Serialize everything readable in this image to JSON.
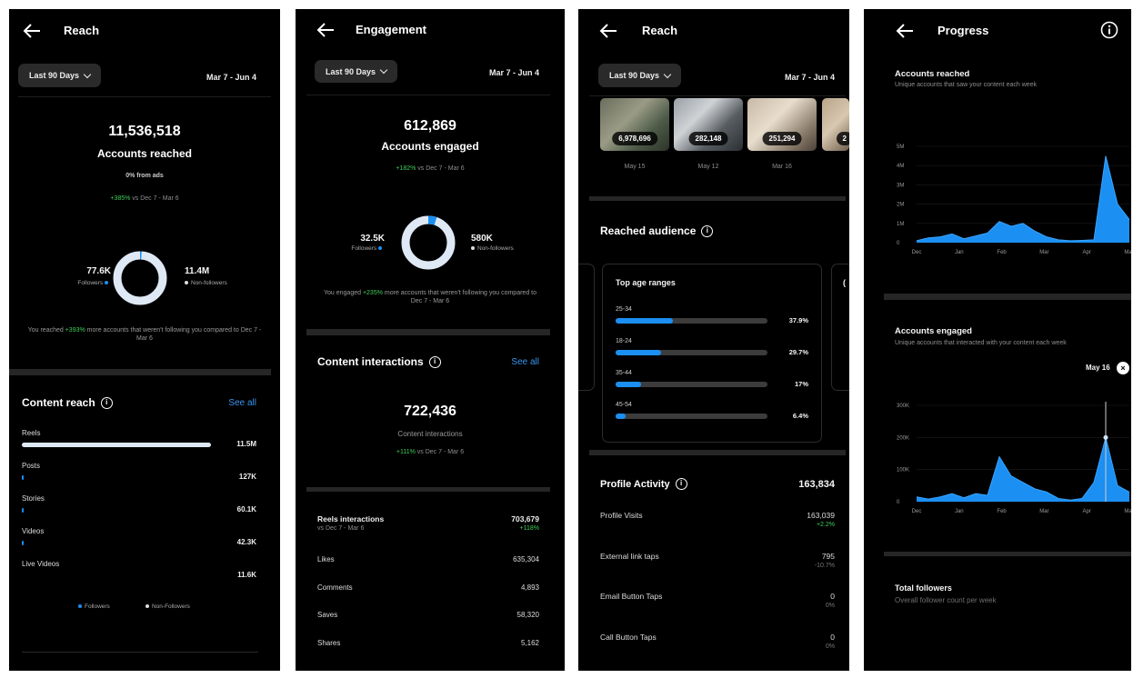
{
  "colors": {
    "accent": "#1b8ff2",
    "positive": "#3ecf5a",
    "background": "#000000"
  },
  "s1": {
    "title": "Reach",
    "filter": "Last 90 Days",
    "date_range": "Mar 7 - Jun 4",
    "total": "11,536,518",
    "total_label": "Accounts reached",
    "from_ads": "0% from ads",
    "change": "+385%",
    "change_suffix": " vs Dec 7 - Mar 6",
    "followers_value": "77.6K",
    "followers_label": "Followers",
    "nonfollowers_value": "11.4M",
    "nonfollowers_label": "Non-followers",
    "note_prefix": "You reached ",
    "note_highlight": "+393%",
    "note_suffix": " more accounts that weren't following you compared to Dec 7 - Mar 6",
    "section_title": "Content reach",
    "see_all": "See all",
    "content": [
      {
        "label": "Reels",
        "value": "11.5M",
        "fraction": 1.0
      },
      {
        "label": "Posts",
        "value": "127K",
        "fraction": 0.011
      },
      {
        "label": "Stories",
        "value": "60.1K",
        "fraction": 0.005
      },
      {
        "label": "Videos",
        "value": "42.3K",
        "fraction": 0.0
      },
      {
        "label": "Live Videos",
        "value": "11.6K",
        "fraction": 0.0
      }
    ],
    "legend_followers": "Followers",
    "legend_nonfollowers": "Non-Followers"
  },
  "s2": {
    "title": "Engagement",
    "filter": "Last 90 Days",
    "date_range": "Mar 7 - Jun 4",
    "total": "612,869",
    "total_label": "Accounts engaged",
    "change": "+182%",
    "change_suffix": " vs Dec 7 - Mar 6",
    "followers_value": "32.5K",
    "followers_label": "Followers",
    "nonfollowers_value": "580K",
    "nonfollowers_label": "Non-followers",
    "note_prefix": "You engaged ",
    "note_highlight": "+235%",
    "note_suffix": " more accounts that weren't following you compared to Dec 7 - Mar 6",
    "section_title": "Content interactions",
    "see_all": "See all",
    "interactions_total": "722,436",
    "interactions_label": "Content interactions",
    "interactions_change": "+111%",
    "interactions_change_suffix": " vs Dec 7 - Mar 6",
    "reels_label": "Reels interactions",
    "reels_sub": "vs Dec 7 - Mar 6",
    "reels_value": "703,679",
    "reels_change": "+118%",
    "rows": [
      {
        "label": "Likes",
        "value": "635,304"
      },
      {
        "label": "Comments",
        "value": "4,893"
      },
      {
        "label": "Saves",
        "value": "58,320"
      },
      {
        "label": "Shares",
        "value": "5,162"
      }
    ]
  },
  "s3": {
    "title": "Reach",
    "filter": "Last 90 Days",
    "date_range": "Mar 7 - Jun 4",
    "thumbs": [
      {
        "value": "6,978,696",
        "date": "May 15"
      },
      {
        "value": "282,148",
        "date": "May 12"
      },
      {
        "value": "251,294",
        "date": "Mar 16"
      },
      {
        "value": "2",
        "date": ""
      }
    ],
    "audience_title": "Reached audience",
    "age_title": "Top age ranges",
    "ages": [
      {
        "label": "25-34",
        "value": "37.9%",
        "fraction": 0.379
      },
      {
        "label": "18-24",
        "value": "29.7%",
        "fraction": 0.297
      },
      {
        "label": "35-44",
        "value": "17%",
        "fraction": 0.17
      },
      {
        "label": "45-54",
        "value": "6.4%",
        "fraction": 0.064
      }
    ],
    "activity_title": "Profile Activity",
    "activity_total": "163,834",
    "activity": [
      {
        "label": "Profile Visits",
        "value": "163,039",
        "change": "+2.2%"
      },
      {
        "label": "External link taps",
        "value": "795",
        "change": "-10.7%"
      },
      {
        "label": "Email Button Taps",
        "value": "0",
        "change": "0%"
      },
      {
        "label": "Call Button Taps",
        "value": "0",
        "change": "0%"
      }
    ]
  },
  "s4": {
    "title": "Progress",
    "reached_title": "Accounts reached",
    "reached_sub": "Unique accounts that saw your content each week",
    "engaged_title": "Accounts engaged",
    "engaged_sub": "Unique accounts that interacted with your content each week",
    "tooltip_date": "May 16",
    "followers_title": "Total followers",
    "followers_sub": "Overall follower count per week"
  },
  "chart_data": [
    {
      "type": "area",
      "title": "Accounts reached",
      "x": [
        "Dec",
        "",
        "Jan",
        "",
        "Feb",
        "",
        "Mar",
        "",
        "Apr",
        "",
        "May",
        ""
      ],
      "x_ticks": [
        "Dec",
        "Jan",
        "Feb",
        "Mar",
        "Apr",
        "May"
      ],
      "y_ticks": [
        "0",
        "1M",
        "2M",
        "3M",
        "4M",
        "5M"
      ],
      "ylim": [
        0,
        5000000
      ],
      "series": [
        {
          "values": [
            100000,
            250000,
            300000,
            450000,
            200000,
            350000,
            500000,
            1100000,
            850000,
            1000000,
            600000,
            300000,
            150000,
            100000,
            120000,
            150000,
            4500000,
            2000000,
            1200000
          ]
        }
      ]
    },
    {
      "type": "area",
      "title": "Accounts engaged",
      "x_ticks": [
        "Dec",
        "Jan",
        "Feb",
        "Mar",
        "Apr",
        "May"
      ],
      "y_ticks": [
        "0",
        "100K",
        "200K",
        "300K"
      ],
      "ylim": [
        0,
        300000
      ],
      "series": [
        {
          "values": [
            15000,
            8000,
            15000,
            25000,
            12000,
            25000,
            20000,
            140000,
            80000,
            60000,
            40000,
            30000,
            10000,
            5000,
            10000,
            60000,
            200000,
            50000,
            30000
          ]
        }
      ]
    }
  ]
}
